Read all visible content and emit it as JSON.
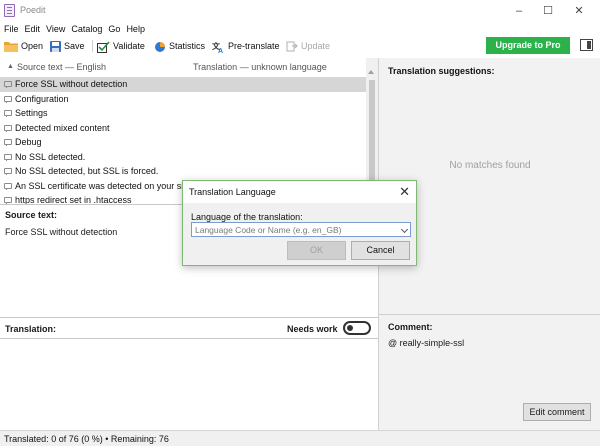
{
  "window": {
    "title": "Poedit"
  },
  "menu": [
    "File",
    "Edit",
    "View",
    "Catalog",
    "Go",
    "Help"
  ],
  "toolbar": {
    "open": "Open",
    "save": "Save",
    "validate": "Validate",
    "statistics": "Statistics",
    "pretranslate": "Pre-translate",
    "update": "Update",
    "upgrade": "Upgrade to Pro"
  },
  "list": {
    "col_source": "Source text — English",
    "col_translation": "Translation — unknown language",
    "rows": [
      "Force SSL without detection",
      "Configuration",
      "Settings",
      "Detected mixed content",
      "Debug",
      "No SSL detected.",
      "No SSL detected, but SSL is forced.",
      "An SSL certificate was detected on your site.",
      "https redirect set in .htaccess"
    ],
    "selected_index": 0
  },
  "editor": {
    "source_label": "Source text:",
    "source_value": "Force SSL without detection",
    "translation_label": "Translation:",
    "needs_work_label": "Needs work"
  },
  "right_panel": {
    "suggestions_title": "Translation suggestions:",
    "no_matches": "No matches found",
    "comment_title": "Comment:",
    "comment_value": "@ really-simple-ssl",
    "edit_comment": "Edit comment"
  },
  "status": {
    "text": "Translated: 0 of 76 (0 %)  •  Remaining: 76"
  },
  "dialog": {
    "title": "Translation Language",
    "label": "Language of the translation:",
    "placeholder": "Language Code or Name (e.g. en_GB)",
    "ok": "OK",
    "cancel": "Cancel"
  },
  "colors": {
    "accent_green": "#2cb24a",
    "dialog_border": "#7fba73",
    "selection": "#d6d6d6"
  },
  "icons": {
    "open": "folder-icon",
    "save": "floppy-icon",
    "validate": "checkbox-icon",
    "statistics": "pie-chart-icon",
    "pretranslate": "translate-icon",
    "update": "update-icon"
  }
}
